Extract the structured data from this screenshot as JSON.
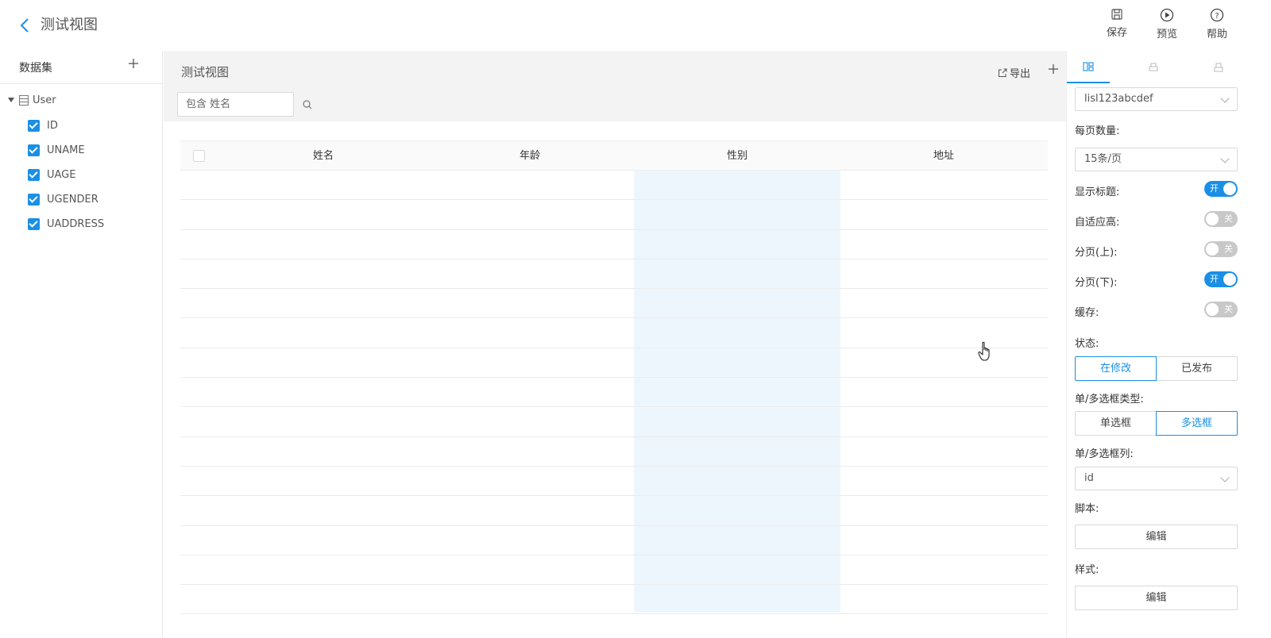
{
  "header": {
    "title": "测试视图",
    "tools": [
      {
        "label": "保存",
        "icon": "save-icon"
      },
      {
        "label": "预览",
        "icon": "play-circle-icon"
      },
      {
        "label": "帮助",
        "icon": "help-circle-icon"
      }
    ]
  },
  "dataset": {
    "title": "数据集",
    "table_name": "User",
    "fields": [
      {
        "name": "ID",
        "checked": true
      },
      {
        "name": "UNAME",
        "checked": true
      },
      {
        "name": "UAGE",
        "checked": true
      },
      {
        "name": "UGENDER",
        "checked": true
      },
      {
        "name": "UADDRESS",
        "checked": true
      }
    ]
  },
  "view": {
    "title": "测试视图",
    "export_label": "导出",
    "search_placeholder": "包含 姓名",
    "columns": [
      "姓名",
      "年龄",
      "性别",
      "地址"
    ],
    "highlighted_column": "性别",
    "row_count": 15
  },
  "settings": {
    "tabs": [
      {
        "icon": "layout-icon",
        "active": true
      },
      {
        "icon": "print-icon",
        "active": false
      },
      {
        "icon": "printer-icon",
        "active": false
      }
    ],
    "datasource_value": "lisl123abcdef",
    "page_size_label": "每页数量:",
    "page_size_value": "15条/页",
    "toggles": [
      {
        "label": "显示标题:",
        "on": true,
        "text": "开"
      },
      {
        "label": "自适应高:",
        "on": false,
        "text": "关"
      },
      {
        "label": "分页(上):",
        "on": false,
        "text": "关"
      },
      {
        "label": "分页(下):",
        "on": true,
        "text": "开"
      },
      {
        "label": "缓存:",
        "on": false,
        "text": "关"
      }
    ],
    "status_label": "状态:",
    "status_options": [
      "在修改",
      "已发布"
    ],
    "status_selected": "在修改",
    "select_type_label": "单/多选框类型:",
    "select_type_options": [
      "单选框",
      "多选框"
    ],
    "select_type_selected": "多选框",
    "select_column_label": "单/多选框列:",
    "select_column_value": "id",
    "script_label": "脚本:",
    "script_button": "编辑",
    "style_label": "样式:",
    "style_button": "编辑"
  },
  "colors": {
    "accent": "#1a8fe6",
    "highlight_column_bg": "#eef6fd"
  }
}
